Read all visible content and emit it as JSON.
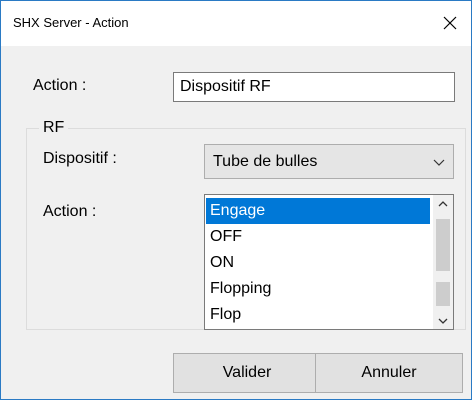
{
  "window": {
    "title": "SHX Server - Action"
  },
  "form": {
    "action_label": "Action :",
    "action_value": "Dispositif RF"
  },
  "rf_group": {
    "legend": "RF",
    "device_label": "Dispositif :",
    "device_selected": "Tube de bulles",
    "action_label": "Action :",
    "action_options": [
      "Engage",
      "OFF",
      "ON",
      "Flopping",
      "Flop"
    ],
    "selected_action": "Engage"
  },
  "buttons": {
    "validate": "Valider",
    "cancel": "Annuler"
  },
  "colors": {
    "accent": "#0078d7",
    "window_border": "#2a7ac4",
    "dialog_bg": "#f0f0f0"
  },
  "icons": {
    "close": "close-icon",
    "dropdown": "chevron-down-icon",
    "scroll_up": "scroll-up-arrow-icon",
    "scroll_down": "scroll-down-arrow-icon"
  }
}
